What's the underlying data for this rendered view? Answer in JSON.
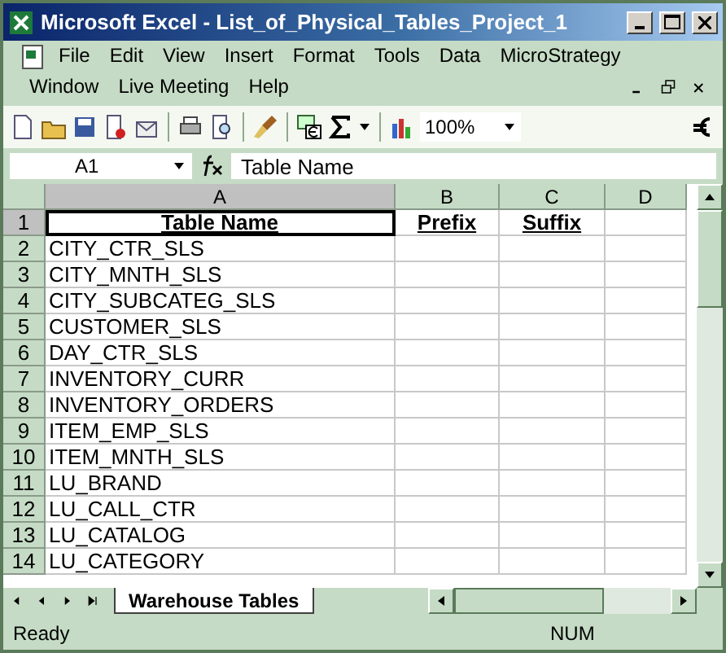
{
  "window": {
    "title": "Microsoft Excel - List_of_Physical_Tables_Project_1"
  },
  "menu_rows": [
    [
      "File",
      "Edit",
      "View",
      "Insert",
      "Format",
      "Tools",
      "Data",
      "MicroStrategy"
    ],
    [
      "Window",
      "Live Meeting",
      "Help"
    ]
  ],
  "toolbar": {
    "zoom": "100%"
  },
  "formula_bar": {
    "name_box": "A1",
    "formula": "Table Name"
  },
  "columns": [
    {
      "label": "A",
      "selected": true
    },
    {
      "label": "B",
      "selected": false
    },
    {
      "label": "C",
      "selected": false
    },
    {
      "label": "D",
      "selected": false
    }
  ],
  "rows": [
    {
      "number": "1",
      "selected": true,
      "kind": "header",
      "cells": [
        "Table Name",
        "Prefix",
        "Suffix",
        ""
      ]
    },
    {
      "number": "2",
      "selected": false,
      "kind": "data",
      "cells": [
        "CITY_CTR_SLS"
      ]
    },
    {
      "number": "3",
      "selected": false,
      "kind": "data",
      "cells": [
        "CITY_MNTH_SLS"
      ]
    },
    {
      "number": "4",
      "selected": false,
      "kind": "data",
      "cells": [
        "CITY_SUBCATEG_SLS"
      ]
    },
    {
      "number": "5",
      "selected": false,
      "kind": "data",
      "cells": [
        "CUSTOMER_SLS"
      ]
    },
    {
      "number": "6",
      "selected": false,
      "kind": "data",
      "cells": [
        "DAY_CTR_SLS"
      ]
    },
    {
      "number": "7",
      "selected": false,
      "kind": "data",
      "cells": [
        "INVENTORY_CURR"
      ]
    },
    {
      "number": "8",
      "selected": false,
      "kind": "data",
      "cells": [
        "INVENTORY_ORDERS"
      ]
    },
    {
      "number": "9",
      "selected": false,
      "kind": "data",
      "cells": [
        "ITEM_EMP_SLS"
      ]
    },
    {
      "number": "10",
      "selected": false,
      "kind": "data",
      "cells": [
        "ITEM_MNTH_SLS"
      ]
    },
    {
      "number": "11",
      "selected": false,
      "kind": "data",
      "cells": [
        "LU_BRAND"
      ]
    },
    {
      "number": "12",
      "selected": false,
      "kind": "data",
      "cells": [
        "LU_CALL_CTR"
      ]
    },
    {
      "number": "13",
      "selected": false,
      "kind": "data",
      "cells": [
        "LU_CATALOG"
      ]
    },
    {
      "number": "14",
      "selected": false,
      "kind": "data",
      "cells": [
        "LU_CATEGORY"
      ]
    }
  ],
  "sheet_tabs": [
    {
      "label": "Warehouse Tables",
      "selected": true
    }
  ],
  "status_bar": {
    "status": "Ready",
    "indicator": "NUM"
  }
}
